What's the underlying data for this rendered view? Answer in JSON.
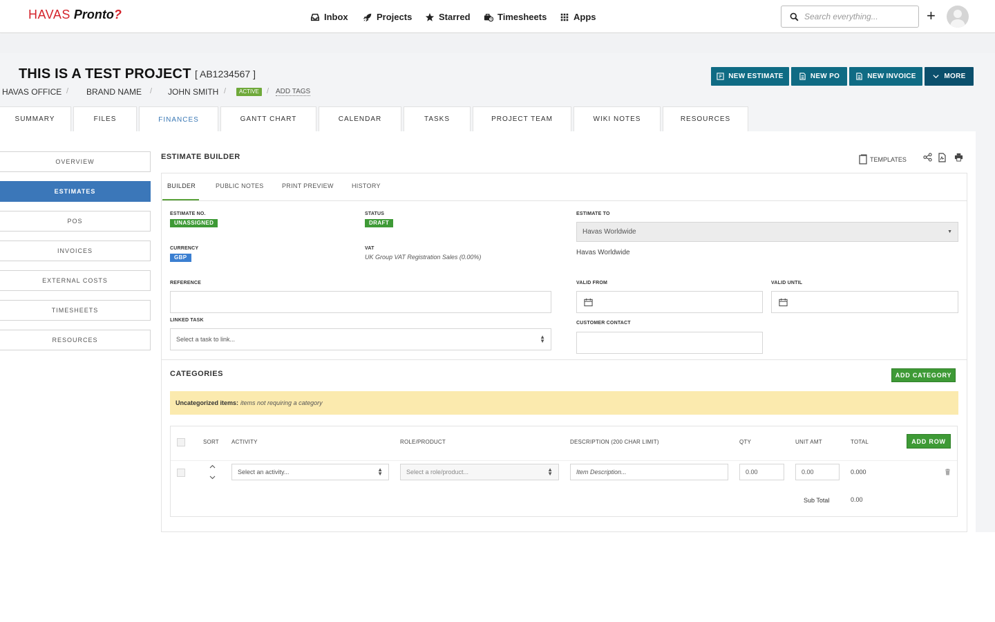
{
  "brand": {
    "part1": "HAVAS",
    "part2": "Pronto",
    "part3": "?"
  },
  "nav": [
    "Inbox",
    "Projects",
    "Starred",
    "Timesheets",
    "Apps"
  ],
  "search": {
    "placeholder": "Search everything..."
  },
  "topbar": {
    "plus": "+"
  },
  "project": {
    "title": "THIS IS A TEST PROJECT",
    "code": "[ AB1234567 ]",
    "breadcrumb": [
      "HAVAS OFFICE",
      "BRAND NAME",
      "JOHN SMITH"
    ],
    "separator": "/",
    "status": "ACTIVE",
    "add_tags": "ADD TAGS"
  },
  "actions": [
    {
      "label": "NEW ESTIMATE",
      "icon": "estimate-icon"
    },
    {
      "label": "NEW PO",
      "icon": "document-icon"
    },
    {
      "label": "NEW INVOICE",
      "icon": "document-icon"
    },
    {
      "label": "MORE",
      "icon": "chevron-down-icon"
    }
  ],
  "tabs": [
    "SUMMARY",
    "FILES",
    "FINANCES",
    "GANTT CHART",
    "CALENDAR",
    "TASKS",
    "PROJECT TEAM",
    "WIKI NOTES",
    "RESOURCES"
  ],
  "active_tab": "FINANCES",
  "sidebar": [
    "OVERVIEW",
    "ESTIMATES",
    "POS",
    "INVOICES",
    "EXTERNAL COSTS",
    "TIMESHEETS",
    "RESOURCES"
  ],
  "active_sidebar": "ESTIMATES",
  "estimate": {
    "title": "ESTIMATE BUILDER",
    "templates": "TEMPLATES",
    "subtabs": [
      "BUILDER",
      "PUBLIC NOTES",
      "PRINT PREVIEW",
      "HISTORY"
    ],
    "fields": {
      "estimate_no_label": "ESTIMATE NO.",
      "estimate_no_value": "UNASSIGNED",
      "status_label": "STATUS",
      "status_value": "DRAFT",
      "estimate_to_label": "ESTIMATE TO",
      "estimate_to_value": "Havas Worldwide",
      "estimate_to_text": "Havas Worldwide",
      "currency_label": "CURRENCY",
      "currency_value": "GBP",
      "vat_label": "VAT",
      "vat_value": "UK Group VAT Registration Sales (0.00%)",
      "reference_label": "REFERENCE",
      "reference_value": "",
      "valid_from_label": "VALID FROM",
      "valid_until_label": "VALID UNTIL",
      "linked_task_label": "LINKED TASK",
      "linked_task_placeholder": "Select a task to link...",
      "customer_contact_label": "CUSTOMER CONTACT"
    }
  },
  "categories": {
    "title": "CATEGORIES",
    "add_button": "ADD CATEGORY",
    "uncategorized_bold": "Uncategorized items:",
    "uncategorized_italic": "items not requiring a category",
    "columns": [
      "SORT",
      "ACTIVITY",
      "ROLE/PRODUCT",
      "DESCRIPTION (200 CHAR LIMIT)",
      "QTY",
      "UNIT AMT",
      "TOTAL"
    ],
    "add_row": "ADD ROW",
    "row": {
      "activity_placeholder": "Select an activity...",
      "role_placeholder": "Select a role/product...",
      "description_placeholder": "Item Description...",
      "qty": "0.00",
      "unit_amt": "0.00",
      "total": "0.000"
    },
    "subtotal_label": "Sub Total",
    "subtotal_value": "0.00"
  },
  "colors": {
    "primary_dark": "#0f6b84",
    "sidebar_active": "#3b77b9",
    "green": "#3e9a36",
    "badge_blue": "#3b7fd1",
    "brand_red": "#d4232b",
    "uncategorized_bg": "#fbeaae"
  }
}
